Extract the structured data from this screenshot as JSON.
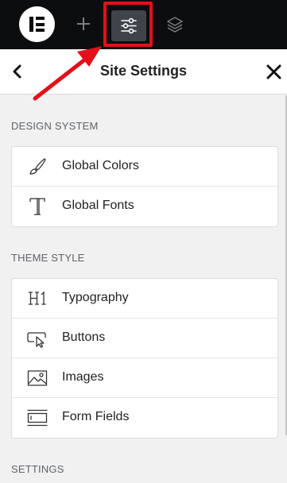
{
  "topbar": {
    "logo_icon": "elementor-logo-icon",
    "add_icon": "plus-icon",
    "settings_icon": "sliders-icon",
    "layers_icon": "layers-icon",
    "highlight_color": "#e3101a"
  },
  "header": {
    "title": "Site Settings",
    "back_icon": "chevron-left-icon",
    "close_icon": "close-icon"
  },
  "sections": {
    "design_system": {
      "title": "DESIGN SYSTEM",
      "items": [
        {
          "label": "Global Colors",
          "icon": "brush-icon"
        },
        {
          "label": "Global Fonts",
          "icon": "typeface-icon"
        }
      ]
    },
    "theme_style": {
      "title": "THEME STYLE",
      "items": [
        {
          "label": "Typography",
          "icon": "heading-h1-icon"
        },
        {
          "label": "Buttons",
          "icon": "button-cursor-icon"
        },
        {
          "label": "Images",
          "icon": "image-icon"
        },
        {
          "label": "Form Fields",
          "icon": "form-fields-icon"
        }
      ]
    },
    "settings": {
      "title": "SETTINGS"
    }
  }
}
